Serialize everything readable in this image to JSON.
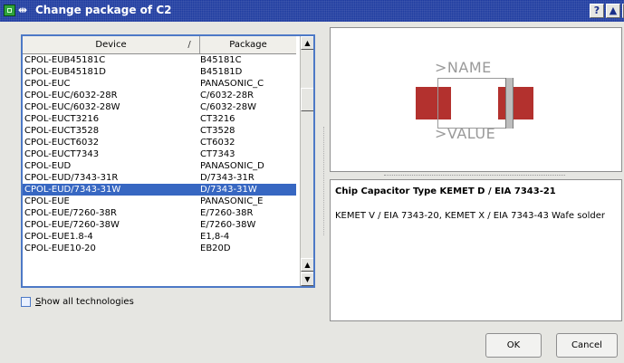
{
  "window": {
    "title": "Change package of C2",
    "buttons": {
      "help": "?",
      "maximize": "▲",
      "close": "x"
    }
  },
  "list": {
    "headers": {
      "device": "Device",
      "sort_indicator": "/",
      "package": "Package"
    },
    "rows": [
      {
        "device": "CPOL-EUB45181C",
        "package": "B45181C"
      },
      {
        "device": "CPOL-EUB45181D",
        "package": "B45181D"
      },
      {
        "device": "CPOL-EUC",
        "package": "PANASONIC_C"
      },
      {
        "device": "CPOL-EUC/6032-28R",
        "package": "C/6032-28R"
      },
      {
        "device": "CPOL-EUC/6032-28W",
        "package": "C/6032-28W"
      },
      {
        "device": "CPOL-EUCT3216",
        "package": "CT3216"
      },
      {
        "device": "CPOL-EUCT3528",
        "package": "CT3528"
      },
      {
        "device": "CPOL-EUCT6032",
        "package": "CT6032"
      },
      {
        "device": "CPOL-EUCT7343",
        "package": "CT7343"
      },
      {
        "device": "CPOL-EUD",
        "package": "PANASONIC_D"
      },
      {
        "device": "CPOL-EUD/7343-31R",
        "package": "D/7343-31R"
      },
      {
        "device": "CPOL-EUD/7343-31W",
        "package": "D/7343-31W",
        "selected": true
      },
      {
        "device": "CPOL-EUE",
        "package": "PANASONIC_E"
      },
      {
        "device": "CPOL-EUE/7260-38R",
        "package": "E/7260-38R"
      },
      {
        "device": "CPOL-EUE/7260-38W",
        "package": "E/7260-38W"
      },
      {
        "device": "CPOL-EUE1.8-4",
        "package": "E1,8-4"
      },
      {
        "device": "CPOL-EUE10-20",
        "package": "EB20D"
      }
    ]
  },
  "show_all_technologies": {
    "label_prefix": "",
    "accel": "S",
    "label_rest": "how all technologies",
    "checked": false
  },
  "preview": {
    "name_text": ">NAME",
    "value_text": ">VALUE"
  },
  "description": {
    "title": "Chip Capacitor Type KEMET D / EIA 7343-21",
    "text": "KEMET V / EIA 7343-20, KEMET X / EIA 7343-43 Wafe solder"
  },
  "buttons": {
    "ok": "OK",
    "cancel": "Cancel"
  },
  "colors": {
    "titlebar": "#1f3ca0",
    "selection": "#3767c2",
    "pad": "#b3312e"
  }
}
